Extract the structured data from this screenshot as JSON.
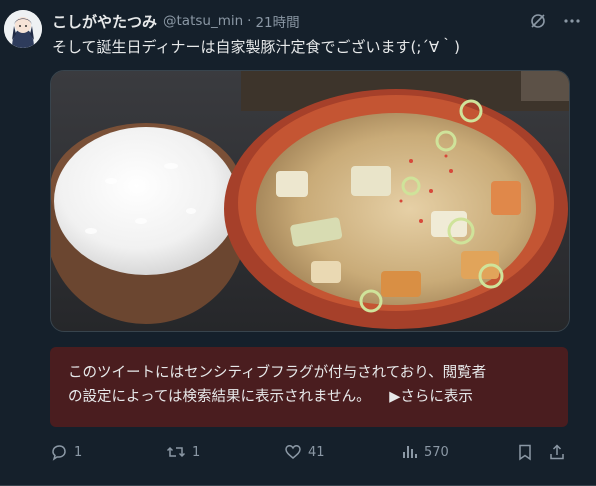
{
  "tweet": {
    "author_name": "こしがやたつみ",
    "handle": "@tatsu_min",
    "separator": "·",
    "time": "21時間",
    "text": "そして誕生日ディナーは自家製豚汁定食でございます(;´∀｀)",
    "media_icon": "no-translate-icon",
    "more_icon": "more-icon"
  },
  "sensitive_notice": {
    "line1": "このツイートにはセンシティブフラグが付与されており、閲覧者",
    "line2": "の設定によっては検索結果に表示されません。",
    "show_more": "▶さらに表示",
    "background": "#4a1d1f"
  },
  "actions": {
    "reply_count": "1",
    "retweet_count": "1",
    "like_count": "41",
    "view_count": "570"
  },
  "colors": {
    "background": "#15202b",
    "text": "#e7e9ea",
    "muted": "#8b98a5"
  }
}
